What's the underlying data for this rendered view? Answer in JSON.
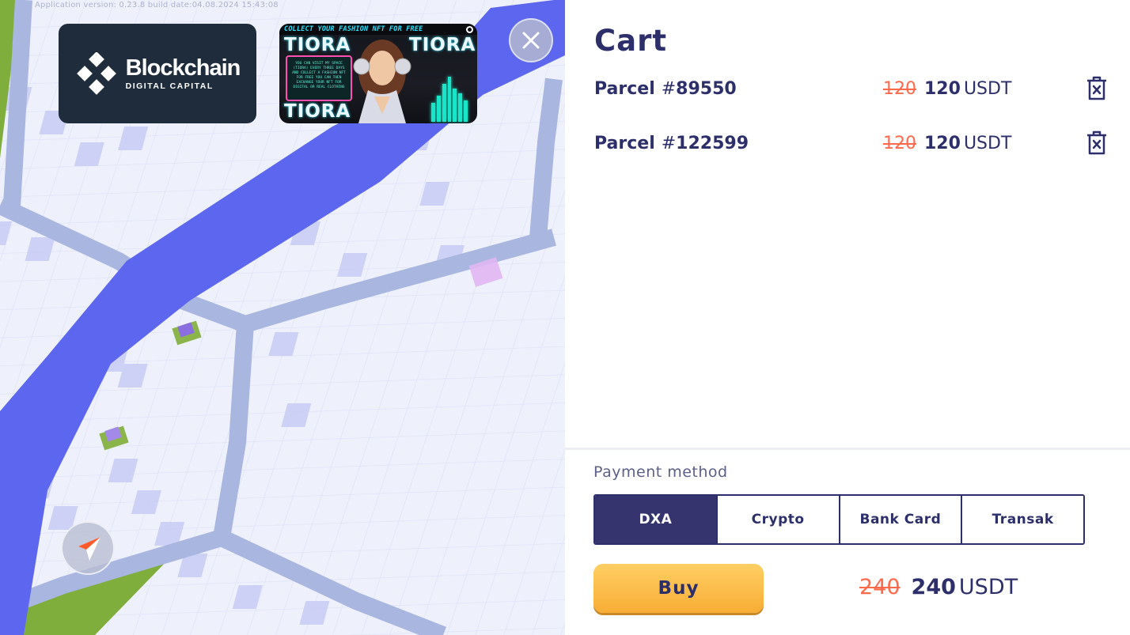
{
  "map": {
    "version_text": "Application version: 0.23.8 build date:04.08.2024 15:43:08",
    "ads": {
      "blockchain": {
        "title": "Blockchain",
        "subtitle": "DIGITAL CAPITAL"
      },
      "tiora": {
        "banner": "COLLECT YOUR FASHION NFT FOR FREE",
        "word": "TIORA",
        "box_text": "YOU CAN VISIT MY SPACE (TIORA) EVERY THREE DAYS AND COLLECT A FASHION NFT FOR FREE YOU CAN THEN EXCHANGE YOUR NFT FOR DIGITAL OR REAL CLOTHING"
      }
    },
    "close_icon": "close-icon",
    "compass_icon": "compass-icon"
  },
  "cart": {
    "title": "Cart",
    "items": [
      {
        "label": "Parcel",
        "hash": "#",
        "number": "89550",
        "old_price": "120",
        "price": "120",
        "currency": "USDT"
      },
      {
        "label": "Parcel",
        "hash": "#",
        "number": "122599",
        "old_price": "120",
        "price": "120",
        "currency": "USDT"
      }
    ],
    "payment": {
      "label": "Payment method",
      "options": [
        "DXA",
        "Crypto",
        "Bank Card",
        "Transak"
      ],
      "selected": "DXA"
    },
    "buy_label": "Buy",
    "total": {
      "old_price": "240",
      "price": "240",
      "currency": "USDT"
    }
  },
  "colors": {
    "primary": "#2d2f6b",
    "strike": "#ff6a4d",
    "buy": "#f8ad36",
    "river": "#5d66ef",
    "road": "#a8b6e0"
  }
}
